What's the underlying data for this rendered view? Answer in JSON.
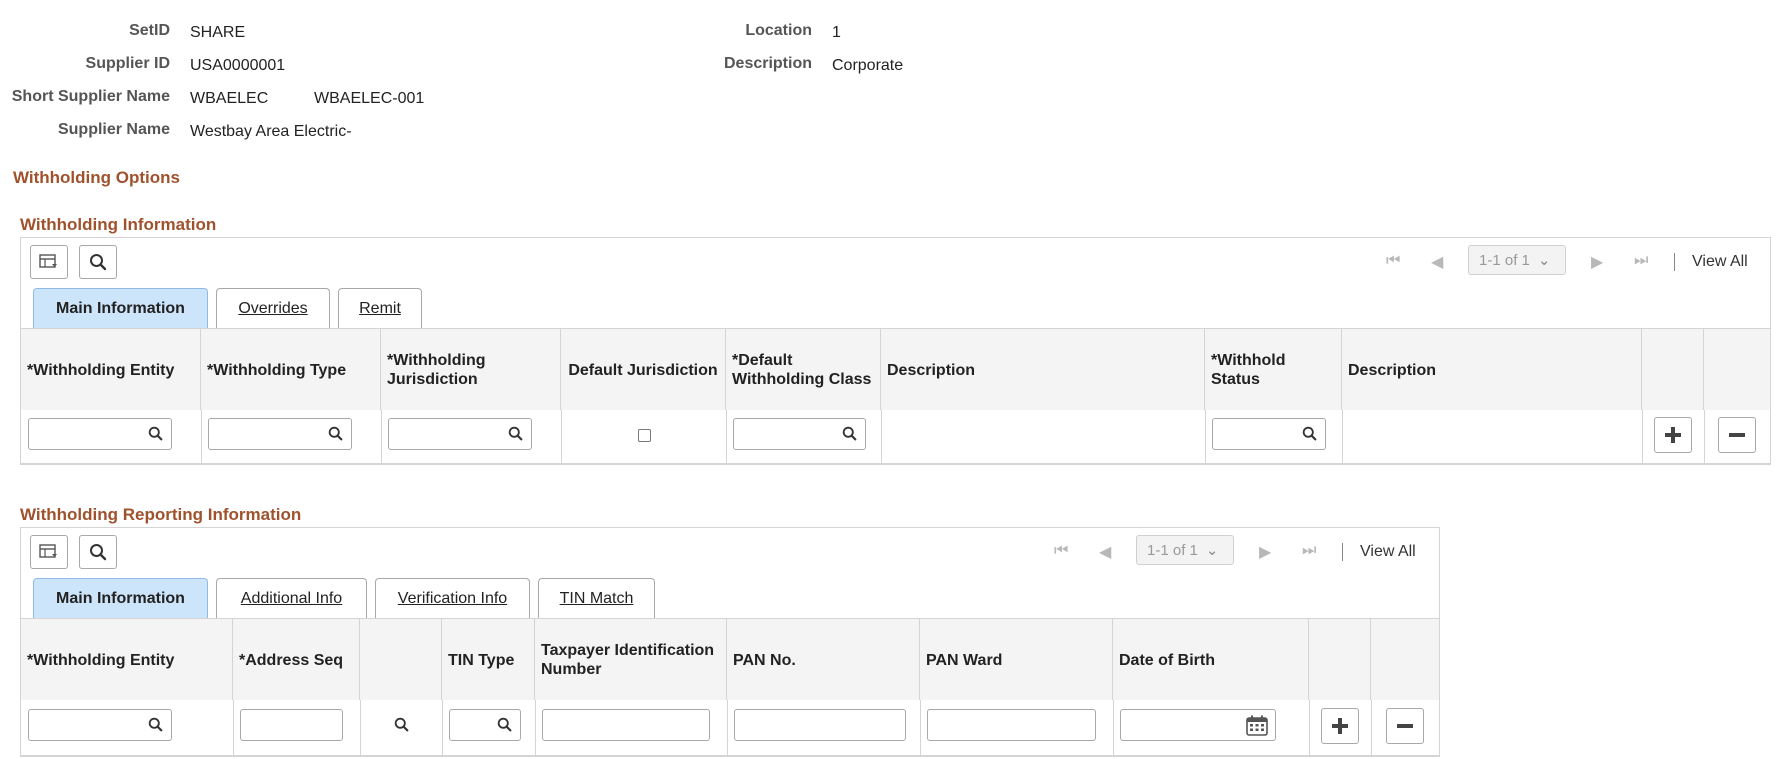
{
  "header": {
    "setid_label": "SetID",
    "setid_value": "SHARE",
    "supplier_id_label": "Supplier ID",
    "supplier_id_value": "USA0000001",
    "short_name_label": "Short Supplier Name",
    "short_name_value": "WBAELEC",
    "short_name_value2": "WBAELEC-001",
    "supplier_name_label": "Supplier Name",
    "supplier_name_value": "Westbay Area Electric-",
    "location_label": "Location",
    "location_value": "1",
    "description_label": "Description",
    "description_value": "Corporate"
  },
  "page_title": "Withholding Options",
  "grid1": {
    "title": "Withholding Information",
    "pager": "1-1 of 1",
    "view_all": "View All",
    "tabs": [
      {
        "label": "Main Information",
        "active": true
      },
      {
        "label": "Overrides",
        "active": false
      },
      {
        "label": "Remit",
        "active": false
      }
    ],
    "columns": [
      "*Withholding Entity",
      "*Withholding Type",
      "*Withholding Jurisdiction",
      "Default Jurisdiction",
      "*Default Withholding Class",
      "Description",
      "*Withhold Status",
      "Description"
    ],
    "row": {
      "entity": "",
      "type": "",
      "jurisdiction": "",
      "default_jurisdiction": false,
      "default_class": "",
      "description": "",
      "status": "",
      "status_description": ""
    }
  },
  "grid2": {
    "title": "Withholding Reporting Information",
    "pager": "1-1 of 1",
    "view_all": "View All",
    "tabs": [
      {
        "label": "Main Information",
        "active": true
      },
      {
        "label": "Additional Info",
        "active": false
      },
      {
        "label": "Verification Info",
        "active": false
      },
      {
        "label": "TIN Match",
        "active": false
      }
    ],
    "columns": [
      "*Withholding Entity",
      "*Address Seq",
      "",
      "TIN Type",
      "Taxpayer Identification Number",
      "PAN No.",
      "PAN Ward",
      "Date of Birth"
    ],
    "row": {
      "entity": "",
      "address_seq": "",
      "tin_type": "",
      "tin": "",
      "pan_no": "",
      "pan_ward": "",
      "dob": ""
    }
  },
  "icons": {
    "grid": "personalize-grid-icon",
    "search": "search-icon",
    "first": "first-page-icon",
    "prev": "previous-page-icon",
    "next": "next-page-icon",
    "last": "last-page-icon",
    "add": "add-row-icon",
    "delete": "delete-row-icon",
    "calendar": "calendar-icon"
  },
  "colors": {
    "section_title": "#a0522d",
    "active_tab": "#cde5fb"
  }
}
